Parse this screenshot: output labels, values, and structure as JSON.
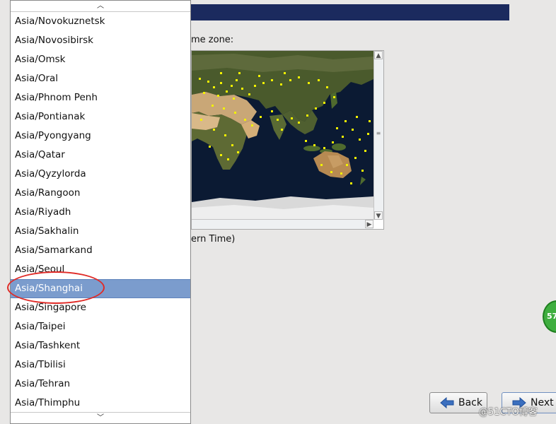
{
  "prompt": "me zone:",
  "timezone_partial": "ern Time)",
  "dropdown": {
    "items": [
      "Asia/Novokuznetsk",
      "Asia/Novosibirsk",
      "Asia/Omsk",
      "Asia/Oral",
      "Asia/Phnom Penh",
      "Asia/Pontianak",
      "Asia/Pyongyang",
      "Asia/Qatar",
      "Asia/Qyzylorda",
      "Asia/Rangoon",
      "Asia/Riyadh",
      "Asia/Sakhalin",
      "Asia/Samarkand",
      "Asia/Seoul",
      "Asia/Shanghai",
      "Asia/Singapore",
      "Asia/Taipei",
      "Asia/Tashkent",
      "Asia/Tbilisi",
      "Asia/Tehran",
      "Asia/Thimphu"
    ],
    "selected": "Asia/Shanghai"
  },
  "buttons": {
    "back": "Back",
    "next": "Next"
  },
  "badge": "57",
  "watermark": "@51CTO博客",
  "colors": {
    "banner": "#1b2a5e",
    "selection": "#7b9ccd",
    "annotation": "#e02b27",
    "city_dot": "#f2f200"
  },
  "icons": {
    "scroll_up": "chevron-up-icon",
    "scroll_down": "chevron-down-icon",
    "back": "arrow-left-icon",
    "next": "arrow-right-icon"
  }
}
